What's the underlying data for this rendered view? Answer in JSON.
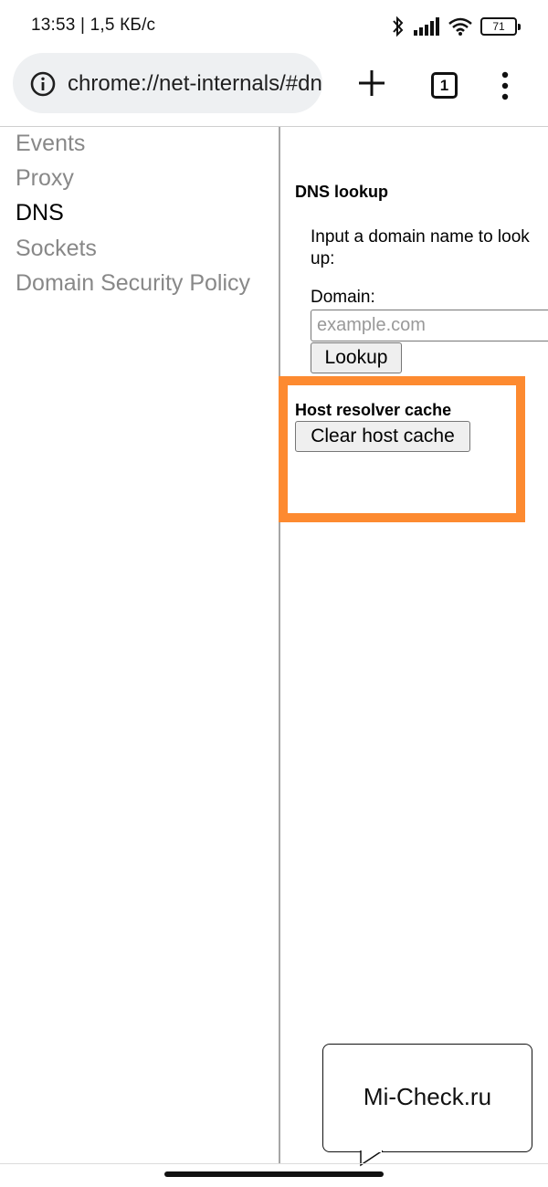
{
  "status_bar": {
    "text": "13:53 | 1,5 КБ/с",
    "battery": "71",
    "icons": [
      "bluetooth-icon",
      "signal-icon",
      "wifi-icon",
      "battery-icon"
    ]
  },
  "browser": {
    "url": "chrome://net-internals/#dns",
    "tab_count": "1",
    "icons": [
      "info-icon",
      "plus-icon",
      "more-vert-icon"
    ]
  },
  "sidebar": {
    "items": [
      {
        "label": "Events",
        "active": false
      },
      {
        "label": "Proxy",
        "active": false
      },
      {
        "label": "DNS",
        "active": true
      },
      {
        "label": "Sockets",
        "active": false
      },
      {
        "label": "Domain Security Policy",
        "active": false
      }
    ]
  },
  "dns_lookup": {
    "title": "DNS lookup",
    "description": "Input a domain name to look up:",
    "domain_label": "Domain:",
    "domain_placeholder": "example.com",
    "domain_value": "",
    "lookup_button": "Lookup"
  },
  "host_cache": {
    "title": "Host resolver cache",
    "clear_button": "Clear host cache"
  },
  "highlight_color": "#fd8a30",
  "watermark": {
    "text": "Mi-Check.ru"
  }
}
